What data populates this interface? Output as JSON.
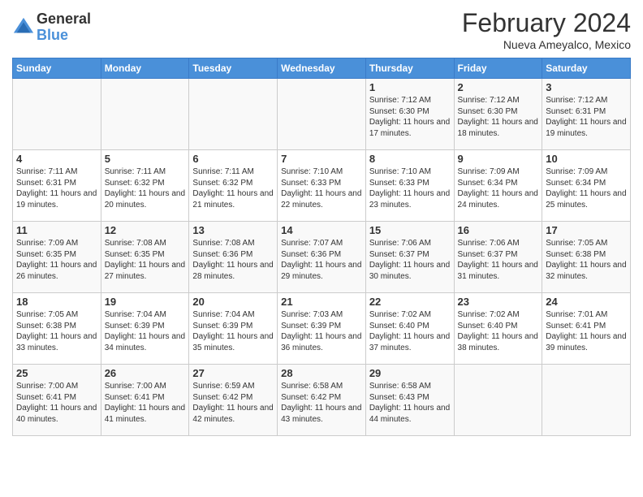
{
  "logo": {
    "general": "General",
    "blue": "Blue"
  },
  "header": {
    "month": "February 2024",
    "location": "Nueva Ameyalco, Mexico"
  },
  "weekdays": [
    "Sunday",
    "Monday",
    "Tuesday",
    "Wednesday",
    "Thursday",
    "Friday",
    "Saturday"
  ],
  "weeks": [
    [
      {
        "day": "",
        "info": ""
      },
      {
        "day": "",
        "info": ""
      },
      {
        "day": "",
        "info": ""
      },
      {
        "day": "",
        "info": ""
      },
      {
        "day": "1",
        "info": "Sunrise: 7:12 AM\nSunset: 6:30 PM\nDaylight: 11 hours and 17 minutes."
      },
      {
        "day": "2",
        "info": "Sunrise: 7:12 AM\nSunset: 6:30 PM\nDaylight: 11 hours and 18 minutes."
      },
      {
        "day": "3",
        "info": "Sunrise: 7:12 AM\nSunset: 6:31 PM\nDaylight: 11 hours and 19 minutes."
      }
    ],
    [
      {
        "day": "4",
        "info": "Sunrise: 7:11 AM\nSunset: 6:31 PM\nDaylight: 11 hours and 19 minutes."
      },
      {
        "day": "5",
        "info": "Sunrise: 7:11 AM\nSunset: 6:32 PM\nDaylight: 11 hours and 20 minutes."
      },
      {
        "day": "6",
        "info": "Sunrise: 7:11 AM\nSunset: 6:32 PM\nDaylight: 11 hours and 21 minutes."
      },
      {
        "day": "7",
        "info": "Sunrise: 7:10 AM\nSunset: 6:33 PM\nDaylight: 11 hours and 22 minutes."
      },
      {
        "day": "8",
        "info": "Sunrise: 7:10 AM\nSunset: 6:33 PM\nDaylight: 11 hours and 23 minutes."
      },
      {
        "day": "9",
        "info": "Sunrise: 7:09 AM\nSunset: 6:34 PM\nDaylight: 11 hours and 24 minutes."
      },
      {
        "day": "10",
        "info": "Sunrise: 7:09 AM\nSunset: 6:34 PM\nDaylight: 11 hours and 25 minutes."
      }
    ],
    [
      {
        "day": "11",
        "info": "Sunrise: 7:09 AM\nSunset: 6:35 PM\nDaylight: 11 hours and 26 minutes."
      },
      {
        "day": "12",
        "info": "Sunrise: 7:08 AM\nSunset: 6:35 PM\nDaylight: 11 hours and 27 minutes."
      },
      {
        "day": "13",
        "info": "Sunrise: 7:08 AM\nSunset: 6:36 PM\nDaylight: 11 hours and 28 minutes."
      },
      {
        "day": "14",
        "info": "Sunrise: 7:07 AM\nSunset: 6:36 PM\nDaylight: 11 hours and 29 minutes."
      },
      {
        "day": "15",
        "info": "Sunrise: 7:06 AM\nSunset: 6:37 PM\nDaylight: 11 hours and 30 minutes."
      },
      {
        "day": "16",
        "info": "Sunrise: 7:06 AM\nSunset: 6:37 PM\nDaylight: 11 hours and 31 minutes."
      },
      {
        "day": "17",
        "info": "Sunrise: 7:05 AM\nSunset: 6:38 PM\nDaylight: 11 hours and 32 minutes."
      }
    ],
    [
      {
        "day": "18",
        "info": "Sunrise: 7:05 AM\nSunset: 6:38 PM\nDaylight: 11 hours and 33 minutes."
      },
      {
        "day": "19",
        "info": "Sunrise: 7:04 AM\nSunset: 6:39 PM\nDaylight: 11 hours and 34 minutes."
      },
      {
        "day": "20",
        "info": "Sunrise: 7:04 AM\nSunset: 6:39 PM\nDaylight: 11 hours and 35 minutes."
      },
      {
        "day": "21",
        "info": "Sunrise: 7:03 AM\nSunset: 6:39 PM\nDaylight: 11 hours and 36 minutes."
      },
      {
        "day": "22",
        "info": "Sunrise: 7:02 AM\nSunset: 6:40 PM\nDaylight: 11 hours and 37 minutes."
      },
      {
        "day": "23",
        "info": "Sunrise: 7:02 AM\nSunset: 6:40 PM\nDaylight: 11 hours and 38 minutes."
      },
      {
        "day": "24",
        "info": "Sunrise: 7:01 AM\nSunset: 6:41 PM\nDaylight: 11 hours and 39 minutes."
      }
    ],
    [
      {
        "day": "25",
        "info": "Sunrise: 7:00 AM\nSunset: 6:41 PM\nDaylight: 11 hours and 40 minutes."
      },
      {
        "day": "26",
        "info": "Sunrise: 7:00 AM\nSunset: 6:41 PM\nDaylight: 11 hours and 41 minutes."
      },
      {
        "day": "27",
        "info": "Sunrise: 6:59 AM\nSunset: 6:42 PM\nDaylight: 11 hours and 42 minutes."
      },
      {
        "day": "28",
        "info": "Sunrise: 6:58 AM\nSunset: 6:42 PM\nDaylight: 11 hours and 43 minutes."
      },
      {
        "day": "29",
        "info": "Sunrise: 6:58 AM\nSunset: 6:43 PM\nDaylight: 11 hours and 44 minutes."
      },
      {
        "day": "",
        "info": ""
      },
      {
        "day": "",
        "info": ""
      }
    ]
  ]
}
